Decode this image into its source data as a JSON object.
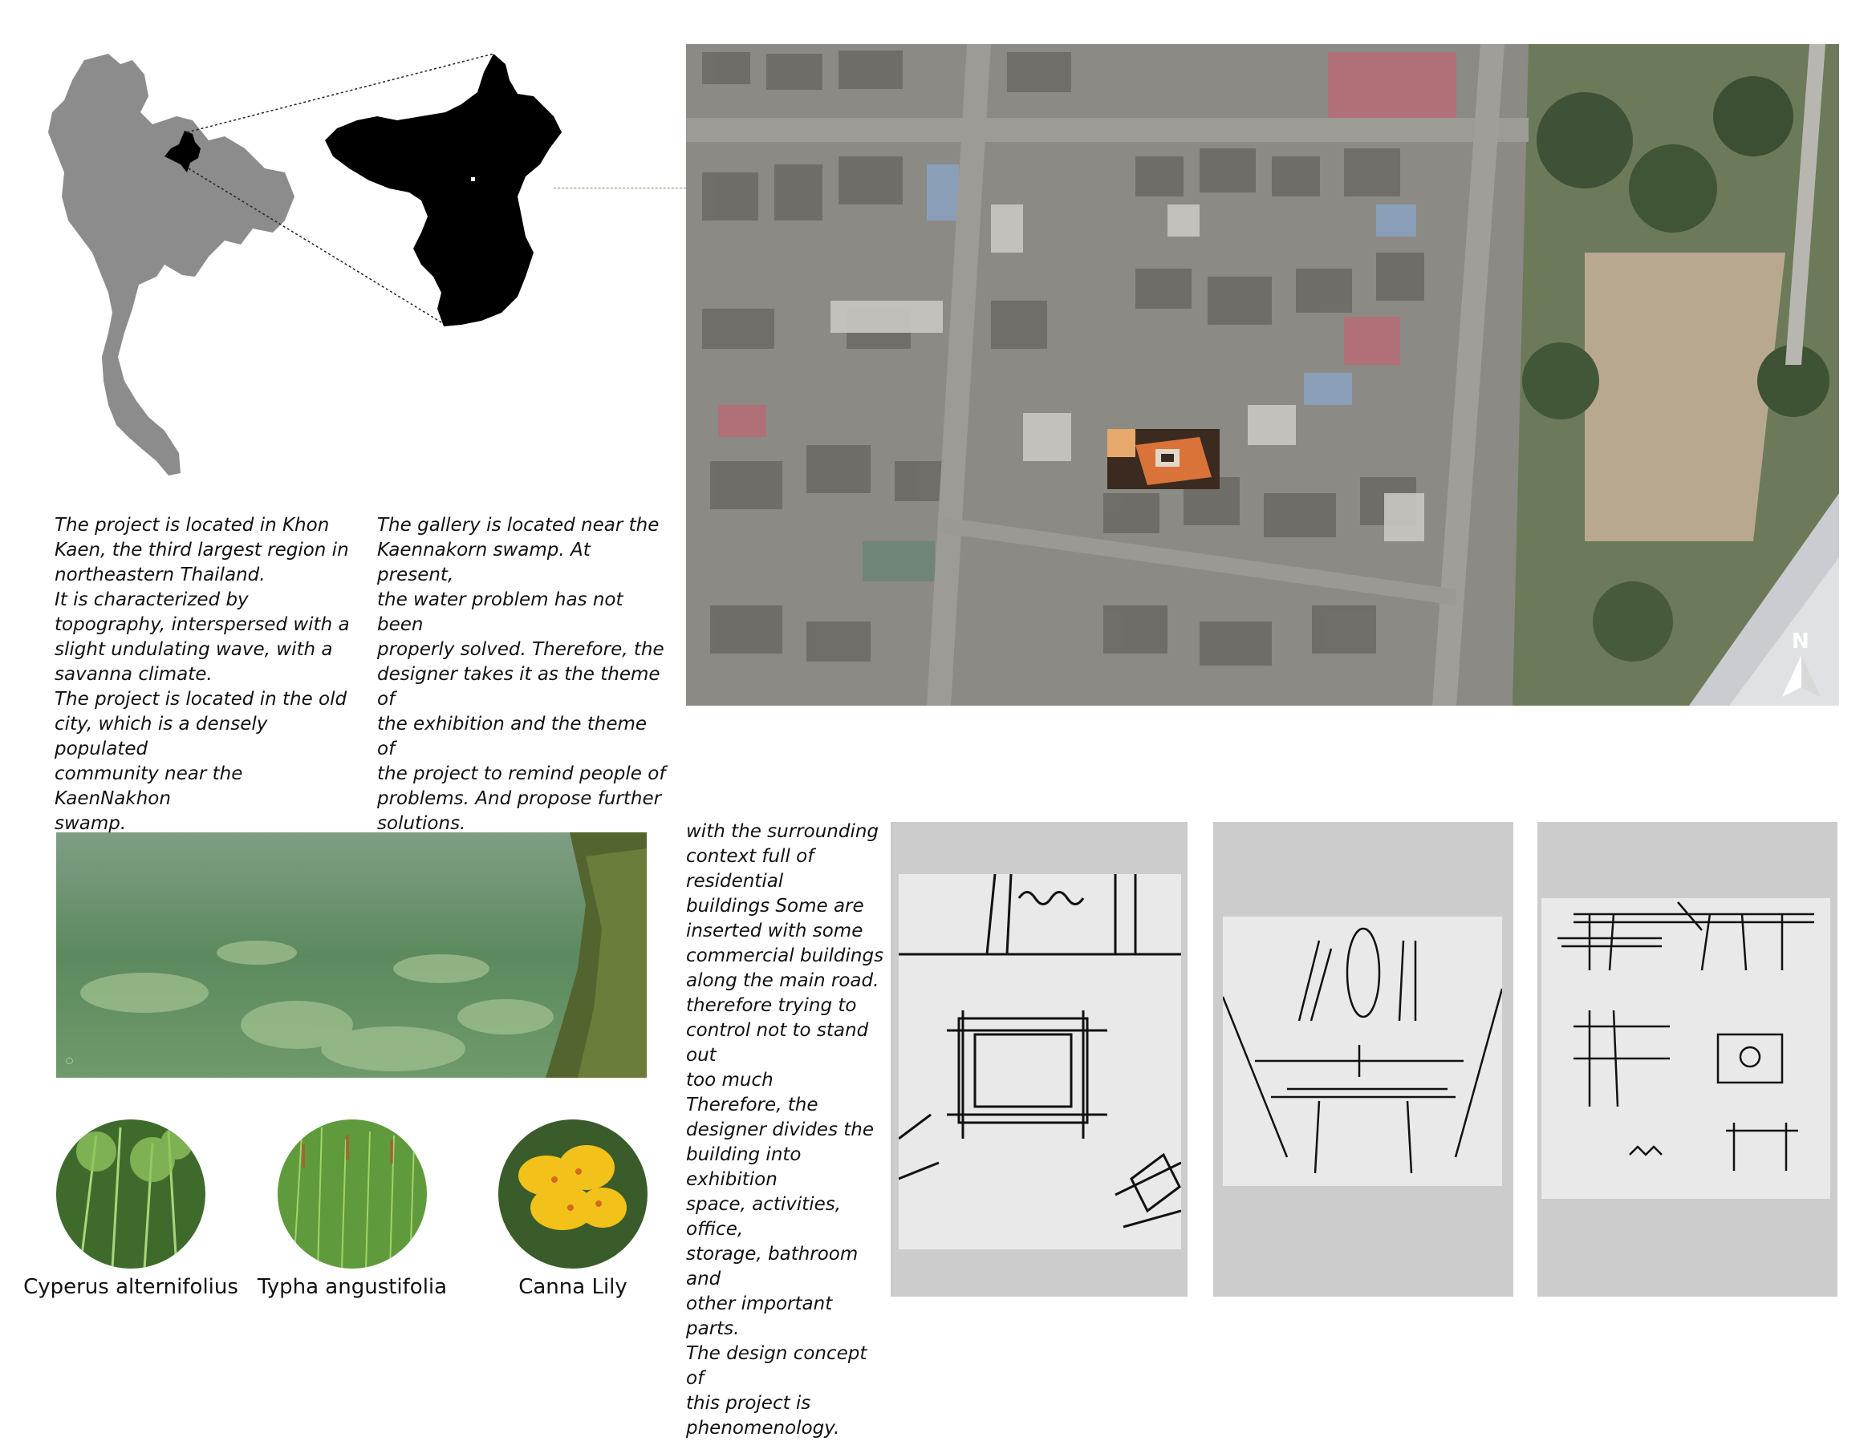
{
  "location_text": {
    "p1": "    The project is located in Khon\nKaen, the third largest region in\nnortheastern Thailand.\n    It is characterized by\ntopography, interspersed with a\nslight undulating wave, with a\nsavanna climate.\n    The project is located in the old\ncity, which is a densely populated\ncommunity near the KaenNakhon\nswamp.",
    "p2": "    The gallery is located near the\nKaennakorn swamp. At present,\nthe water problem has not been\nproperly solved. Therefore, the\ndesigner takes it as the theme of\nthe exhibition and the theme of\nthe project to remind people of\nproblems. And propose further\nsolutions."
  },
  "concept_text": "    with the surrounding\ncontext full of residential\nbuildings Some are\ninserted with some\ncommercial buildings\nalong the main road.\ntherefore trying to\ncontrol not to stand out\ntoo much\n    Therefore, the\ndesigner divides the\nbuilding into exhibition\nspace, activities, office,\nstorage, bathroom and\nother important parts.\nThe design concept of\nthis project is\nphenomenology.",
  "north_arrow_label": "N",
  "plants": [
    {
      "name": "Cyperus alternifolius",
      "icon": "papyrus-plant-photo"
    },
    {
      "name": "Typha angustifolia",
      "icon": "cattail-grass-photo"
    },
    {
      "name": "Canna Lily",
      "icon": "yellow-canna-flower-photo"
    }
  ],
  "colors": {
    "map_gray": "#8c8c8c",
    "province_black": "#000000",
    "swamp_green": "#6f9a6b",
    "sketch_panel_gray": "#cccccc",
    "site_orange": "#e08a3c"
  }
}
